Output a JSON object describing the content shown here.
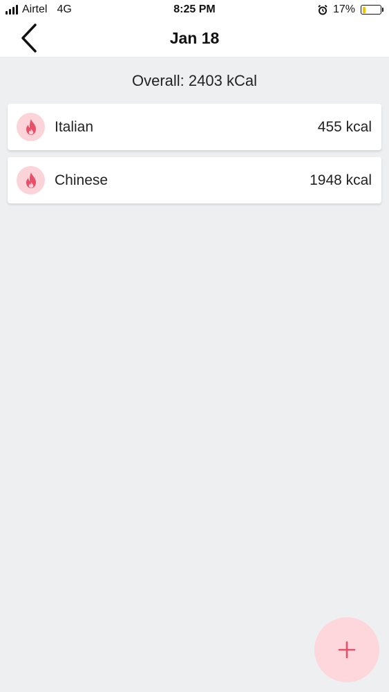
{
  "status_bar": {
    "carrier": "Airtel",
    "network": "4G",
    "time": "8:25 PM",
    "battery_percent_label": "17%",
    "battery_level": 0.17,
    "icons": [
      "signal-icon",
      "alarm-icon",
      "battery-icon"
    ]
  },
  "header": {
    "title": "Jan 18",
    "back_icon": "chevron-left-icon"
  },
  "summary": {
    "overall": "Overall: 2403 kCal"
  },
  "entries": [
    {
      "name": "Italian",
      "kcal": "455 kcal",
      "icon": "flame-icon"
    },
    {
      "name": "Chinese",
      "kcal": "1948 kcal",
      "icon": "flame-icon"
    }
  ],
  "fab": {
    "icon": "plus-icon"
  },
  "colors": {
    "accent": "#e8506a",
    "accent_light": "#fbd4da",
    "background": "#eeeff1",
    "card": "#ffffff",
    "battery": "#f2c100"
  }
}
